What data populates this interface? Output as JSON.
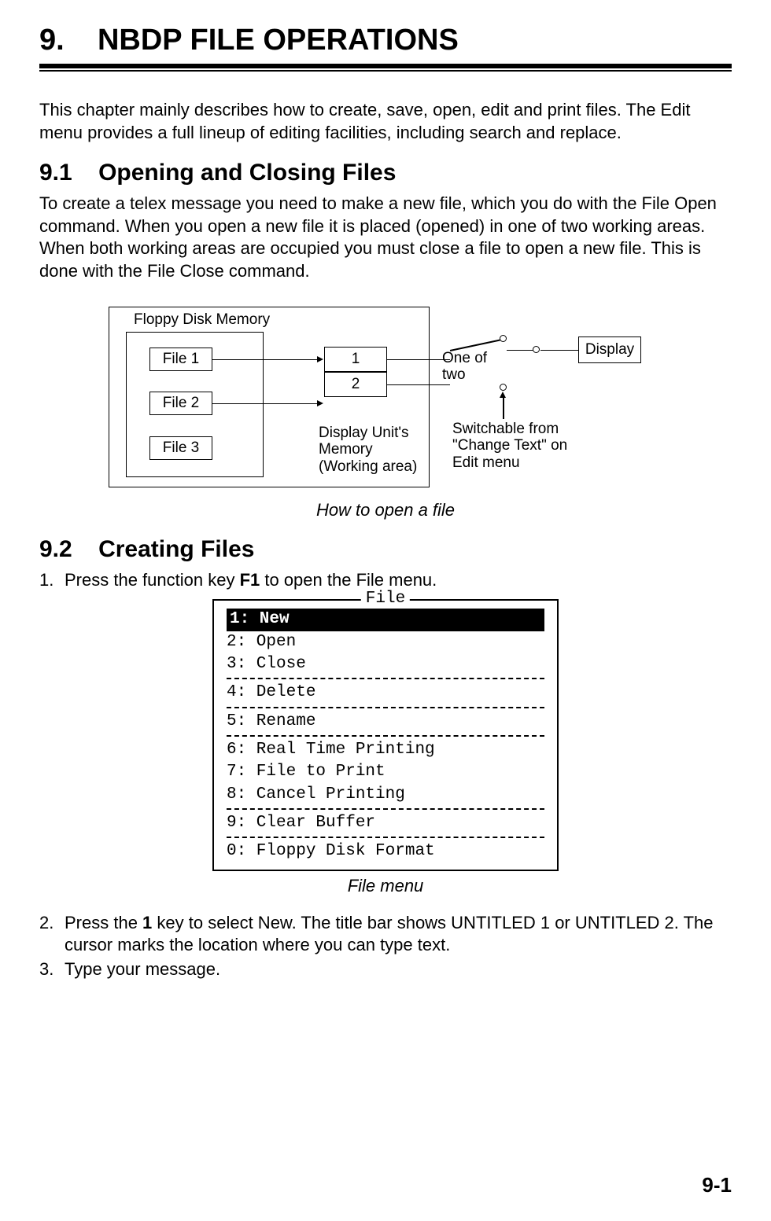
{
  "chapter": {
    "number": "9.",
    "title": "NBDP FILE OPERATIONS"
  },
  "intro": "This chapter mainly describes how to create, save, open, edit and print files. The Edit menu provides a full lineup of editing facilities, including search and replace.",
  "section_9_1": {
    "number": "9.1",
    "title": "Opening and Closing Files",
    "body": "To create a telex message you need to make a new file, which you do with the File Open command. When you open a new file it is placed (opened) in one of two working areas. When both working areas are occupied you must close a file to open a new file. This is done with the File Close command."
  },
  "diagram": {
    "floppy_label": "Floppy Disk Memory",
    "files": [
      "File 1",
      "File 2",
      "File 3"
    ],
    "work_areas": [
      "1",
      "2"
    ],
    "work_area_label": "Display Unit's Memory (Working area)",
    "one_of_two": "One of two",
    "display_box": "Display",
    "switchable": "Switchable from \"Change Text\" on Edit menu",
    "caption": "How to open a file"
  },
  "section_9_2": {
    "number": "9.2",
    "title": "Creating Files",
    "steps": {
      "one_a": "Press the function key ",
      "one_key": "F1",
      "one_b": " to open the File menu.",
      "two_a": "Press the ",
      "two_key": "1",
      "two_b": " key to select New. The title bar shows UNTITLED 1 or UNTITLED 2. The cursor marks the location where you can type text.",
      "three": "Type your message."
    }
  },
  "file_menu": {
    "title": "File",
    "items": {
      "i1": "1: New",
      "i2": "2: Open",
      "i3": "3: Close",
      "i4": "4: Delete",
      "i5": "5: Rename",
      "i6": "6: Real Time Printing",
      "i7": "7: File to Print",
      "i8": "8: Cancel Printing",
      "i9": "9: Clear Buffer",
      "i0": "0: Floppy Disk Format"
    },
    "caption": "File menu"
  },
  "page_number": "9-1"
}
